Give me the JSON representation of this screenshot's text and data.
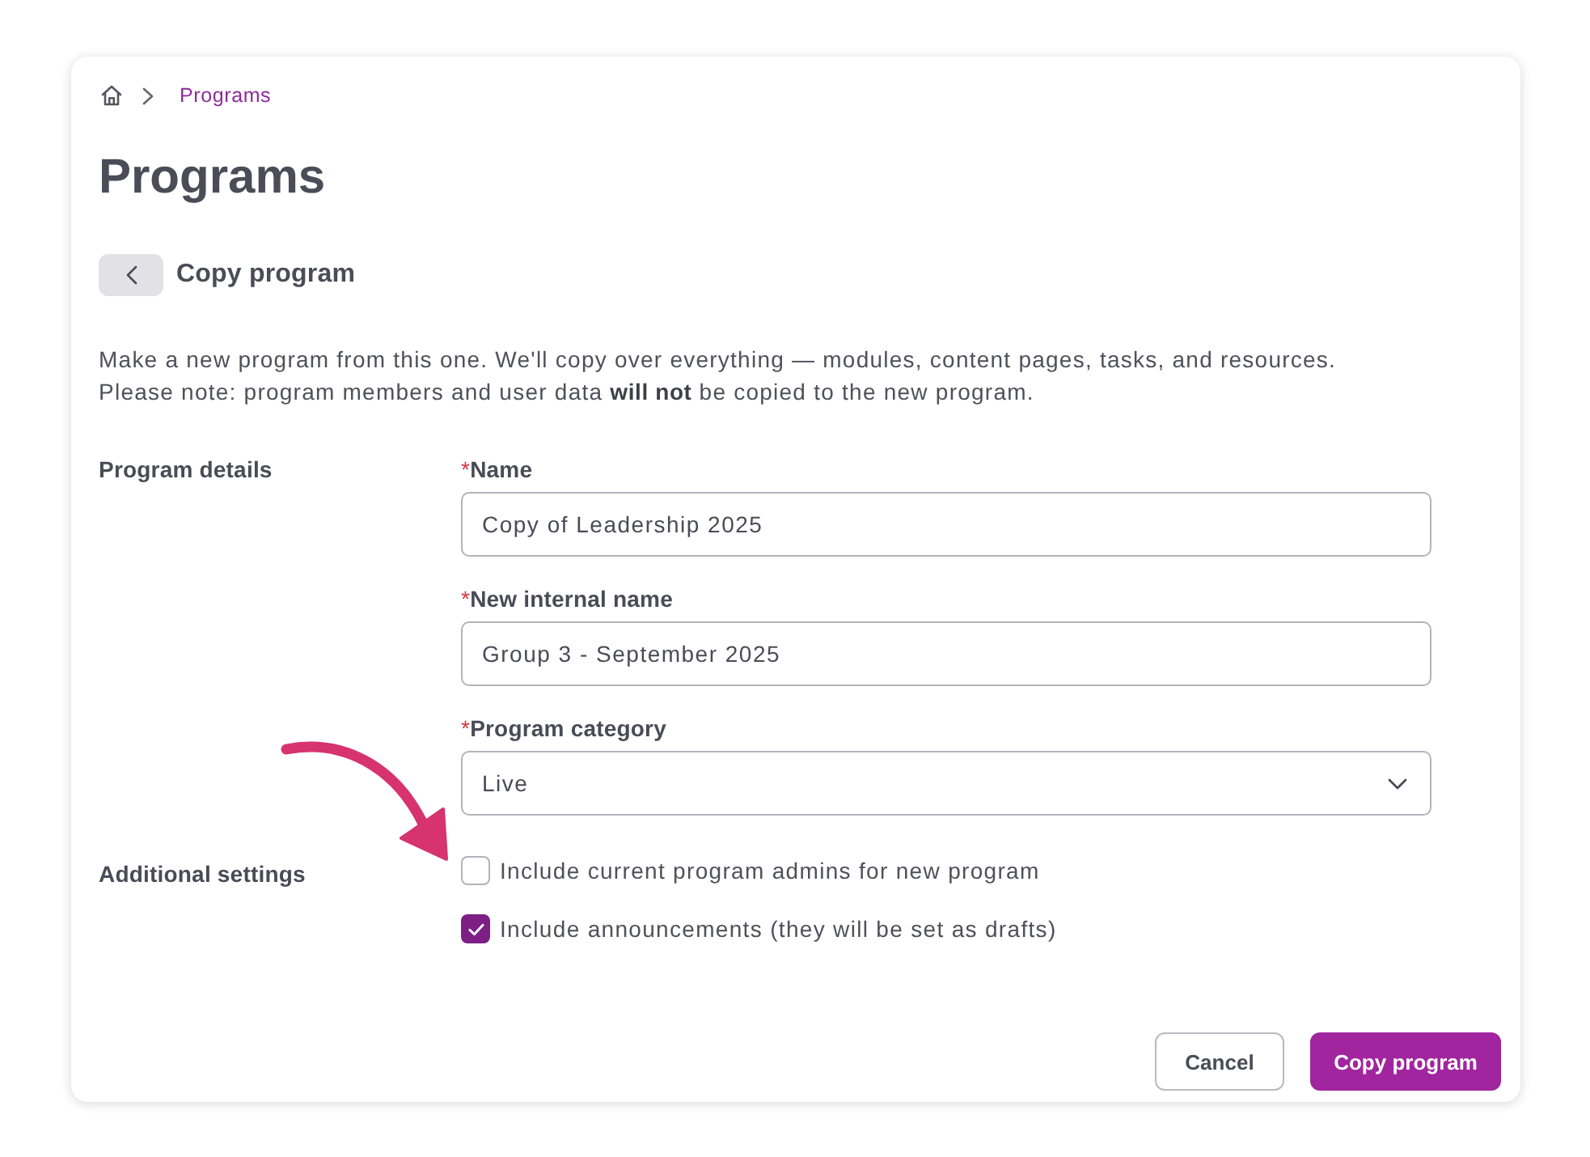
{
  "breadcrumb": {
    "items": [
      "Programs"
    ]
  },
  "page_title": "Programs",
  "subpage_title": "Copy program",
  "description": [
    "Make a new program from this one. We'll copy over everything — modules, content pages, tasks, and resources.",
    "Please note: program members and user data **will not** be copied to the new program."
  ],
  "program_details": {
    "label": "Program details",
    "fields": [
      {
        "kind": "text",
        "required_mark": "*",
        "label": "Name",
        "value": "Copy of Leadership 2025"
      },
      {
        "kind": "text",
        "required_mark": "*",
        "label": "New internal name",
        "value": "Group 3 - September 2025"
      },
      {
        "kind": "select",
        "required_mark": "*",
        "label": "Program category",
        "value": "Live"
      }
    ]
  },
  "additional_settings": {
    "label": "Additional settings",
    "options": [
      {
        "label": "Include current program admins for new program",
        "checked": false,
        "highlighted": true
      },
      {
        "label": "Include announcements (they will be set as drafts)",
        "checked": true,
        "highlighted": false
      }
    ]
  },
  "buttons": [
    {
      "kind": "secondary",
      "label": "Cancel"
    },
    {
      "kind": "primary",
      "label": "Copy program"
    }
  ]
}
